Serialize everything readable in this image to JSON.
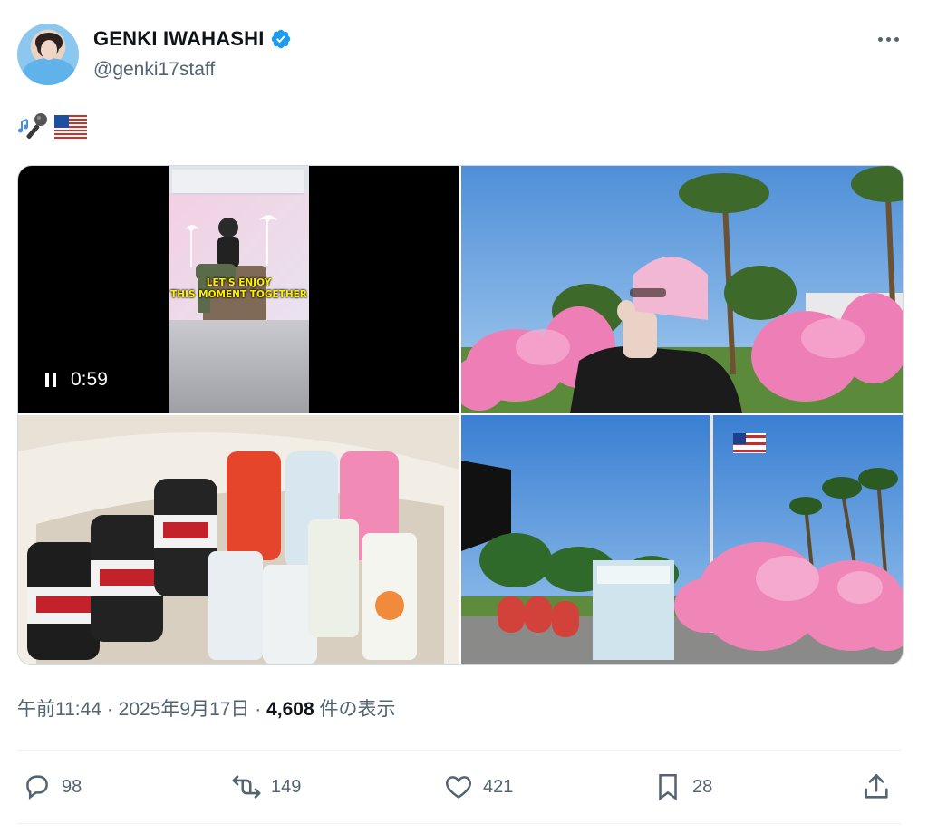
{
  "author": {
    "name": "GENKI IWAHASHI",
    "handle": "@genki17staff",
    "verified_color": "#1d9bf0"
  },
  "tweet": {
    "text_emojis": [
      "🎶🎤",
      "🇺🇸"
    ]
  },
  "media": {
    "video": {
      "caption_line1": "LET'S ENJOY",
      "caption_line2": "THIS MOMENT TOGETHER",
      "duration": "0:59",
      "state": "playing"
    },
    "photos": [
      {
        "description_icon": "photo-pink-beanie-cherry-blossoms"
      },
      {
        "description_icon": "photo-drinks-cooler"
      },
      {
        "description_icon": "photo-flagpole-cherry-blossoms"
      }
    ]
  },
  "timestamp": {
    "time": "午前11:44",
    "sep1": " · ",
    "date": "2025年9月17日",
    "sep2": " · ",
    "views": "4,608",
    "views_label": " 件の表示"
  },
  "actions": {
    "reply_count": "98",
    "retweet_count": "149",
    "like_count": "421",
    "bookmark_count": "28"
  },
  "colors": {
    "text_primary": "#0f1419",
    "text_secondary": "#536471",
    "border": "#cfd9de",
    "accent": "#1d9bf0"
  }
}
